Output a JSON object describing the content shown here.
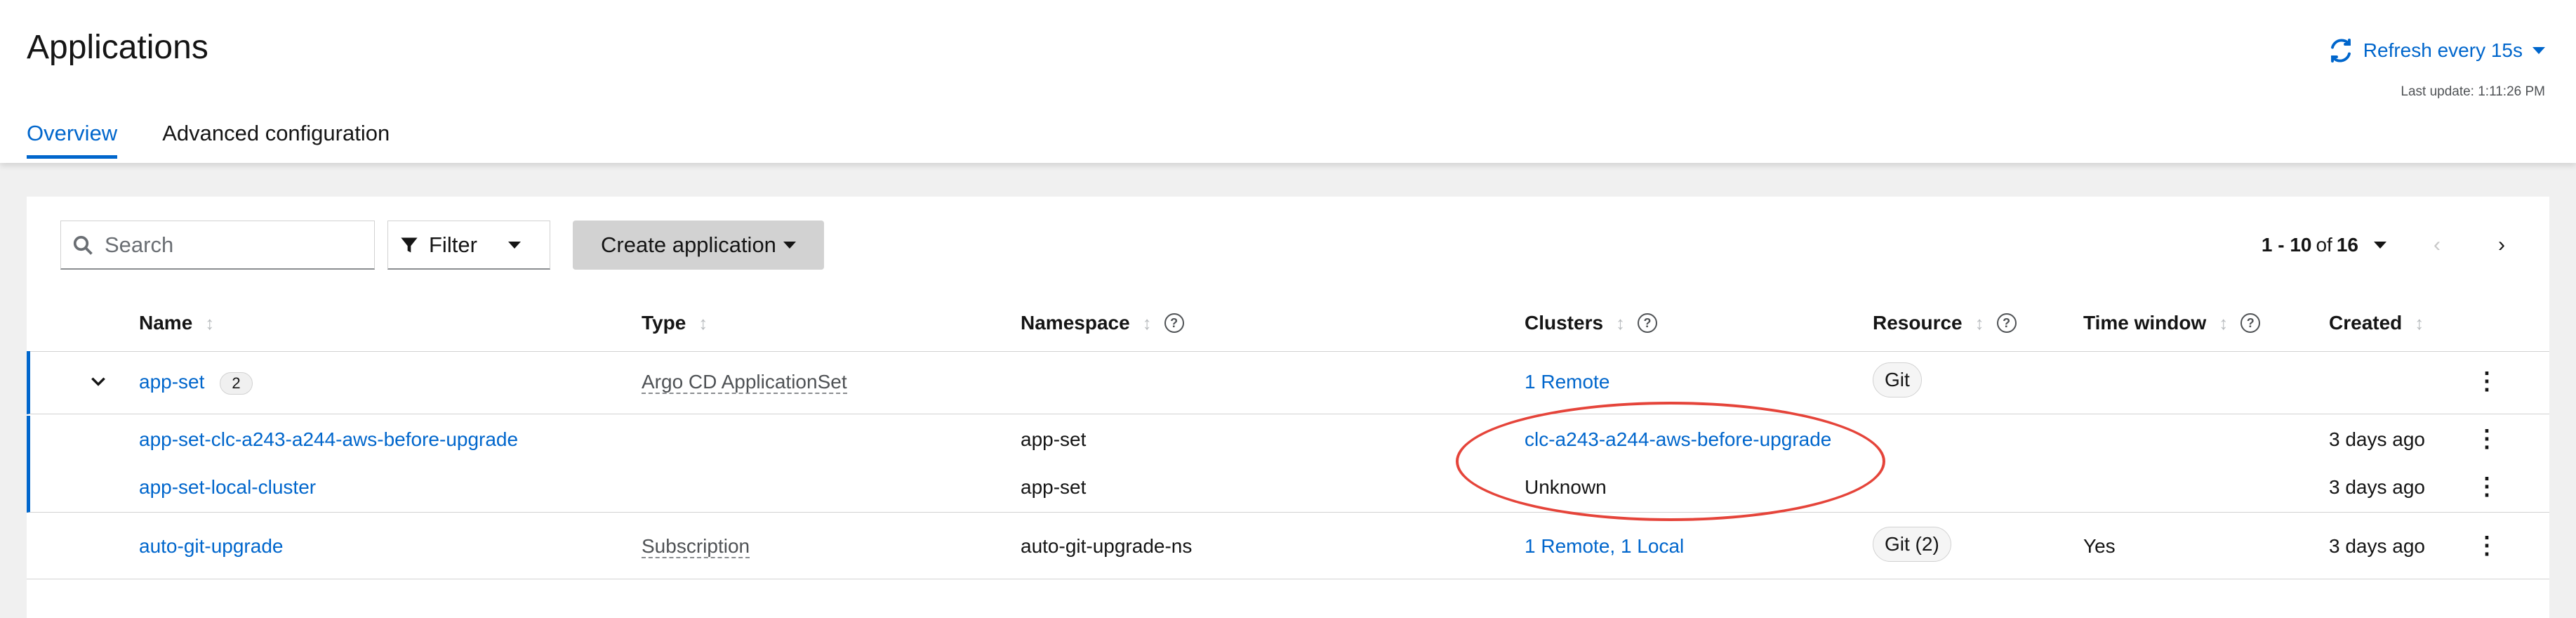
{
  "header": {
    "title": "Applications",
    "refresh_label": "Refresh every 15s",
    "last_update": "Last update: 1:11:26 PM",
    "tabs": [
      {
        "label": "Overview",
        "active": true
      },
      {
        "label": "Advanced configuration",
        "active": false
      }
    ]
  },
  "toolbar": {
    "search_placeholder": "Search",
    "filter_label": "Filter",
    "create_label": "Create application",
    "pagination": {
      "range": "1 - 10",
      "of": "of",
      "total": "16"
    }
  },
  "table": {
    "columns": [
      "Name",
      "Type",
      "Namespace",
      "Clusters",
      "Resource",
      "Time window",
      "Created"
    ],
    "rows": [
      {
        "name": "app-set",
        "count": "2",
        "type": "Argo CD ApplicationSet",
        "namespace": "",
        "clusters": "1 Remote",
        "resource": "Git",
        "time_window": "",
        "created": ""
      },
      {
        "name": "app-set-clc-a243-a244-aws-before-upgrade",
        "type": "",
        "namespace": "app-set",
        "clusters": "clc-a243-a244-aws-before-upgrade",
        "created": "3 days ago"
      },
      {
        "name": "app-set-local-cluster",
        "type": "",
        "namespace": "app-set",
        "clusters": "Unknown",
        "created": "3 days ago"
      },
      {
        "name": "auto-git-upgrade",
        "type": "Subscription",
        "namespace": "auto-git-upgrade-ns",
        "clusters": "1 Remote, 1 Local",
        "resource": "Git (2)",
        "time_window": "Yes",
        "created": "3 days ago"
      }
    ]
  },
  "colors": {
    "link": "#0066cc",
    "callout": "#e5443a",
    "active_tab": "#0066cc"
  },
  "icons": [
    "sync-icon",
    "search-icon",
    "filter-icon",
    "kebab-icon",
    "chevron-down-icon",
    "help-icon",
    "sort-icon"
  ]
}
